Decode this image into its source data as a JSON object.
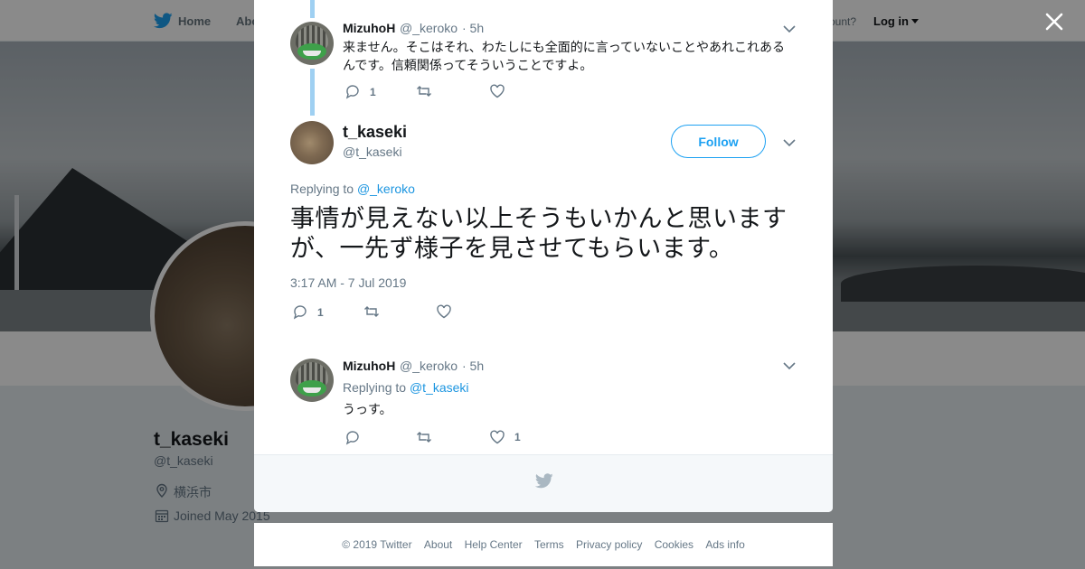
{
  "nav": {
    "home_label": "Home",
    "about_label": "Abo",
    "account_prompt": "ccount?",
    "login_label": "Log in"
  },
  "profile": {
    "name": "t_kaseki",
    "handle": "@t_kaseki",
    "location": "横浜市",
    "joined": "Joined May 2015"
  },
  "thread": {
    "parent_reply": {
      "name": "MizuhoH",
      "handle": "@_keroko",
      "time": "· 5h",
      "text_line1": "来ません。そこはそれ、わたしにも全面的に言っていないことやあれこれある",
      "text_line2": "んです。信頼関係ってそういうことですよ。",
      "reply_count": "1"
    },
    "main_tweet": {
      "name": "t_kaseki",
      "handle": "@t_kaseki",
      "follow_label": "Follow",
      "replying_prefix": "Replying to ",
      "replying_to": "@_keroko",
      "text": "事情が見えない以上そうもいかんと思いますが、一先ず様子を見させてもらいます。",
      "timestamp": "3:17 AM - 7 Jul 2019",
      "reply_count": "1"
    },
    "child_reply": {
      "name": "MizuhoH",
      "handle": "@_keroko",
      "time": "· 5h",
      "replying_prefix": "Replying to ",
      "replying_to": "@t_kaseki",
      "text": "うっす。",
      "like_count": "1"
    }
  },
  "footer": {
    "copyright": "© 2019 Twitter",
    "about": "About",
    "help": "Help Center",
    "terms": "Terms",
    "privacy": "Privacy policy",
    "cookies": "Cookies",
    "ads": "Ads info"
  },
  "colors": {
    "accent": "#1da1f2",
    "link": "#1b95e0",
    "thread_line": "#9fd0f2",
    "muted_text": "#657786"
  }
}
